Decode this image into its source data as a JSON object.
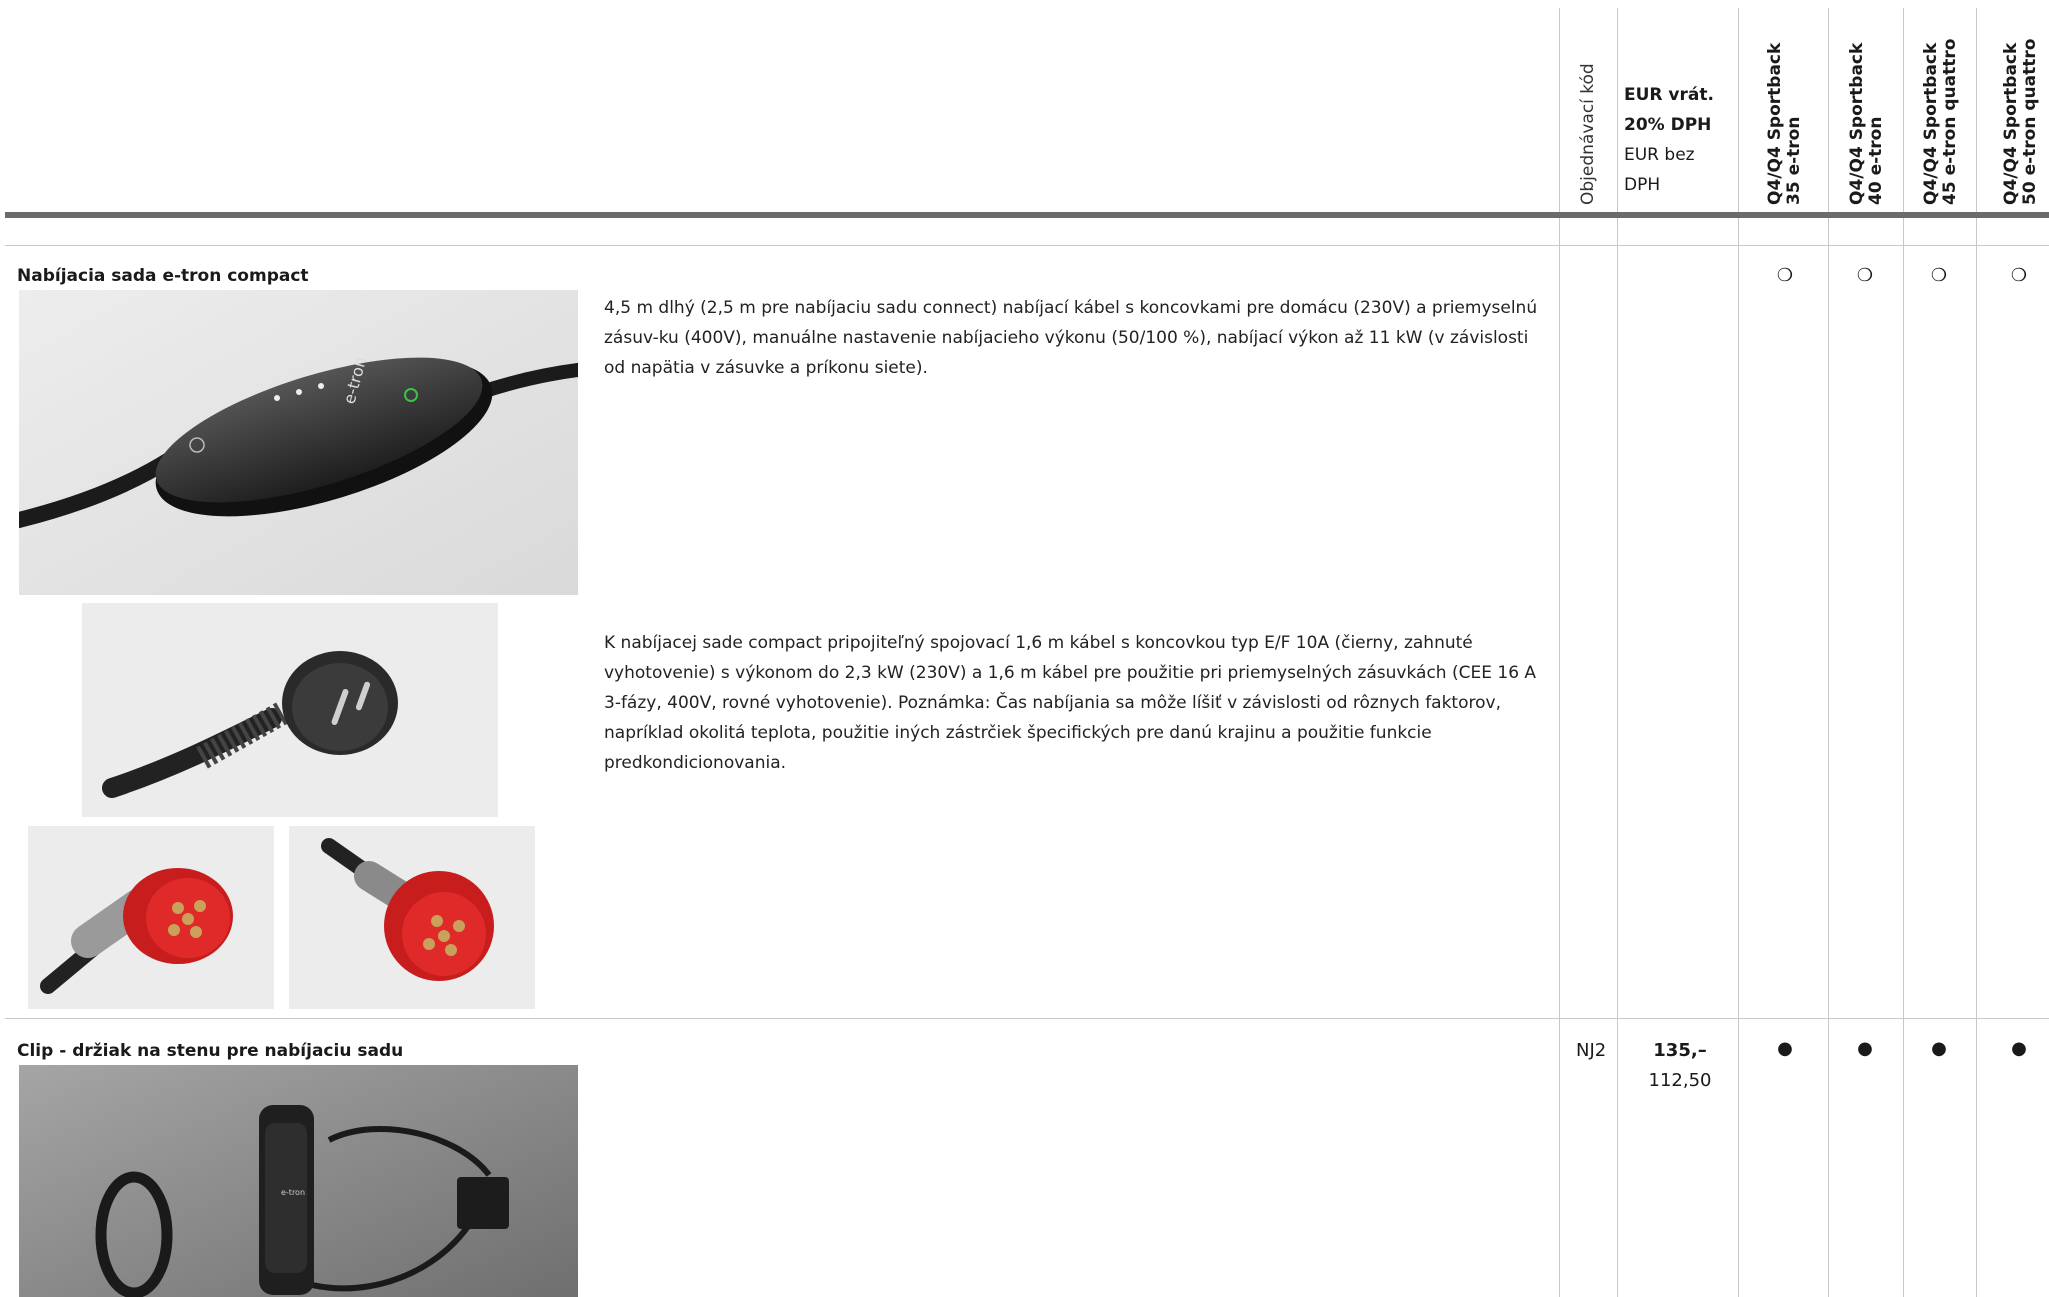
{
  "header": {
    "order_code_label": "Objednávací kód",
    "price_incl_vat": "EUR vrát.",
    "price_incl_vat_2": "20% DPH",
    "price_excl_vat": "EUR bez",
    "price_excl_vat_2": "DPH",
    "models": [
      {
        "line1": "Q4/Q4 Sportback",
        "line2": "35 e-tron"
      },
      {
        "line1": "Q4/Q4 Sportback",
        "line2": "40 e-tron"
      },
      {
        "line1": "Q4/Q4 Sportback",
        "line2": "45 e-tron quattro"
      },
      {
        "line1": "Q4/Q4 Sportback",
        "line2": "50 e-tron quattro"
      }
    ]
  },
  "rows": [
    {
      "title": "Nabíjacia sada e-tron compact",
      "description_1": "4,5 m dlhý (2,5 m pre nabíjaciu sadu connect) nabíjací kábel s koncovkami pre domácu (230V) a priemyselnú zásuv-ku (400V), manuálne nastavenie nabíjacieho výkonu (50/100 %), nabíjací výkon až 11 kW (v závislosti od napätia v zásuvke a príkonu siete).",
      "description_2": "K nabíjacej sade compact pripojiteľný spojovací 1,6 m kábel s koncovkou typ E/F 10A (čierny, zahnuté vyhotovenie) s výkonom do 2,3 kW (230V) a 1,6 m kábel pre použitie pri priemyselných zásuvkách (CEE 16 A 3-fázy, 400V, rovné vyhotovenie). Poznámka: Čas nabíjania sa môže líšiť v závislosti od rôznych faktorov, napríklad okolitá teplota, použitie iných zástrčiek špecifických pre danú krajinu a použitie funkcie predkondicionovania.",
      "order_code": "",
      "marks": [
        "❍",
        "❍",
        "❍",
        "❍"
      ]
    },
    {
      "title": "Clip - držiak na stenu pre nabíjaciu sadu",
      "order_code": "NJ2",
      "price_incl": "135,–",
      "price_excl": "112,50",
      "marks": [
        "●",
        "●",
        "●",
        "●"
      ]
    }
  ],
  "images": {
    "charger_unit": "e-tron",
    "plug_schuko": "",
    "plug_cee_angled": "",
    "plug_cee_straight": "",
    "wall_clip": "e-tron"
  }
}
